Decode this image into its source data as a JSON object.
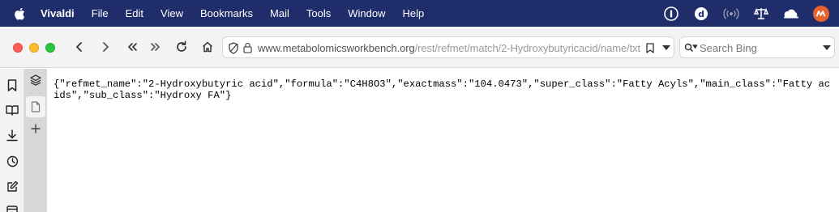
{
  "menubar": {
    "app_name": "Vivaldi",
    "items": [
      "File",
      "Edit",
      "View",
      "Bookmarks",
      "Mail",
      "Tools",
      "Window",
      "Help"
    ],
    "tray_icons": [
      "onepassword-icon",
      "dash-icon",
      "broadcast-icon",
      "scale-icon",
      "cloud-hat-icon",
      "profile-avatar-icon"
    ]
  },
  "toolbar": {
    "url_host": "www.metabolomicsworkbench.org",
    "url_path": "/rest/refmet/match/2-Hydroxybutyricacid/name/txt",
    "search_placeholder": "Search Bing"
  },
  "page": {
    "json_text": "{\"refmet_name\":\"2-Hydroxybutyric acid\",\"formula\":\"C4H8O3\",\"exactmass\":\"104.0473\",\"super_class\":\"Fatty Acyls\",\"main_class\":\"Fatty acids\",\"sub_class\":\"Hydroxy FA\"}"
  },
  "colors": {
    "menubar_bg": "#1f2d6b",
    "avatar": "#e8622c"
  }
}
